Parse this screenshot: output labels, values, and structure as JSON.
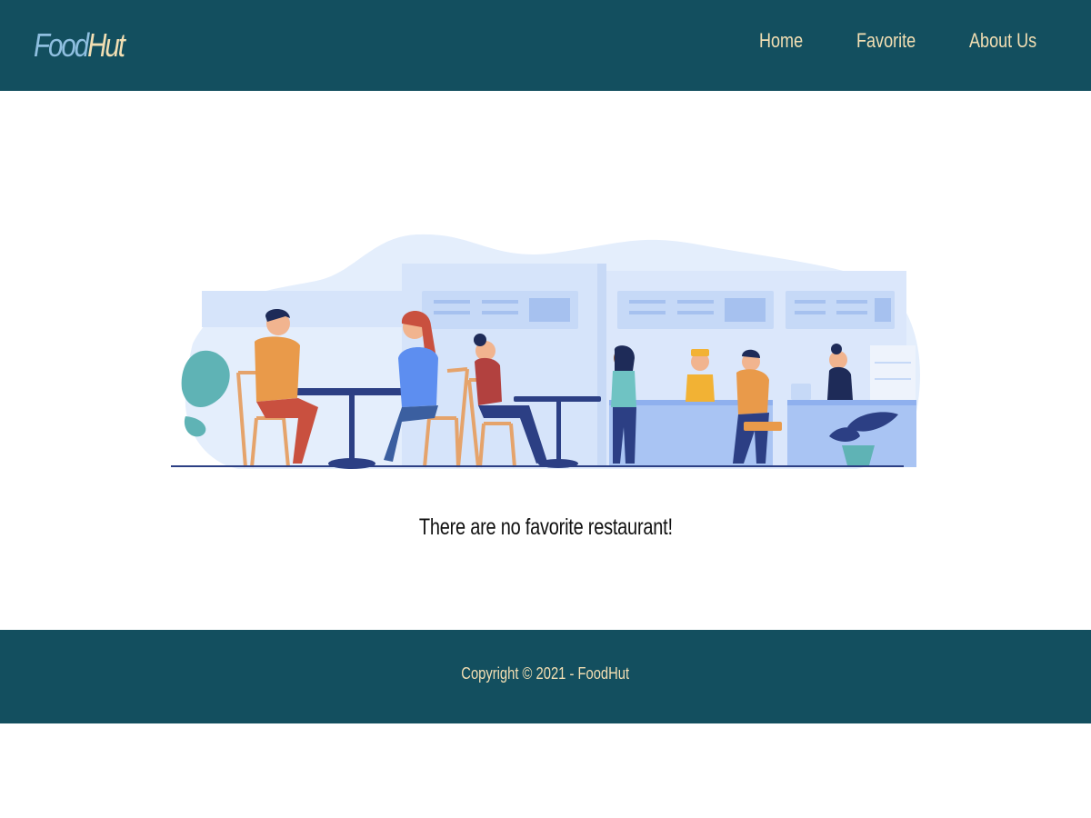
{
  "header": {
    "logo_part1": "Food",
    "logo_part2": "Hut",
    "nav": [
      "Home",
      "Favorite",
      "About Us"
    ]
  },
  "main": {
    "empty_message": "There are no favorite restaurant!",
    "illustration_icon": "restaurant-scene-icon"
  },
  "footer": {
    "copyright": "Copyright © 2021 - FoodHut"
  },
  "colors": {
    "header_bg": "#134f5f",
    "accent_cream": "#f3dfb3",
    "logo_blue": "#8fbfe0"
  }
}
